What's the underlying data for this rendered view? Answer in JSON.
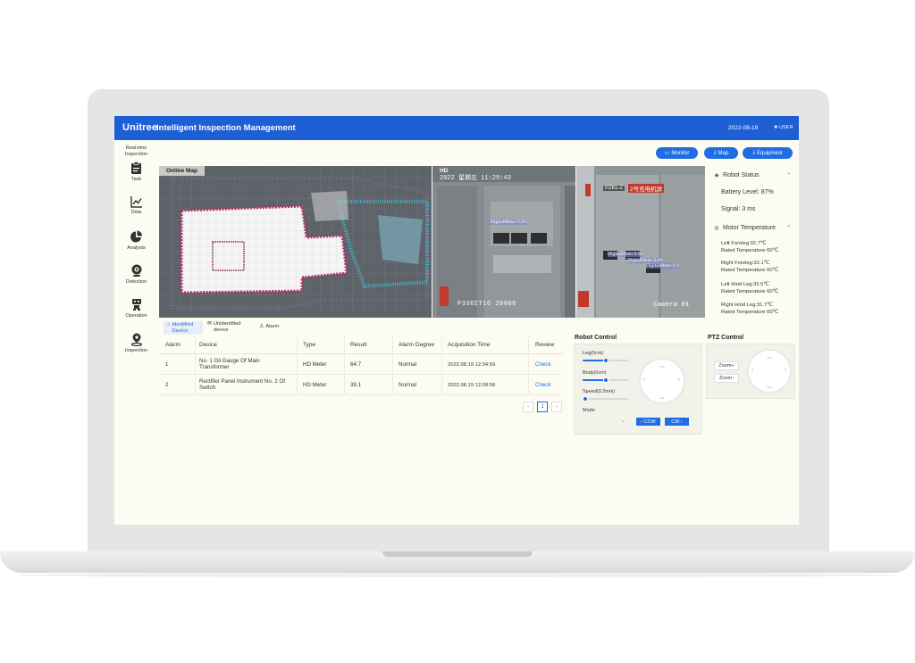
{
  "header": {
    "brand": "Unitree",
    "title": "Intelligent Inspection Management",
    "date": "2022-08-19",
    "user": "✚ USER"
  },
  "sidebar": {
    "heading": "Real-time Inspection",
    "items": [
      {
        "label": "Task",
        "icon": "clipboard-icon"
      },
      {
        "label": "Data",
        "icon": "line-chart-icon"
      },
      {
        "label": "Analysis",
        "icon": "pie-chart-icon"
      },
      {
        "label": "Detection",
        "icon": "camera-icon"
      },
      {
        "label": "Operation",
        "icon": "robot-icon"
      },
      {
        "label": "Inspection",
        "icon": "location-pin-icon"
      }
    ]
  },
  "actions": {
    "monitor": "Monitor",
    "map": "Map",
    "equipment": "Equipment"
  },
  "map_panel": {
    "label": "Online Map"
  },
  "camera": {
    "hd_label": "HD",
    "timestamp": "2022 星期五 11:29:43",
    "detections": [
      "DigitalMeter 0.93",
      "DigitalMeter 0.92",
      "DigitalMeter 0.89",
      "DigitalMeter 0.9"
    ],
    "overlay_left": "P336IT16 20006",
    "overlay_right": "Camera 01",
    "panel_plate": "PZ61-Z",
    "panel_sign": "2号充电机屏"
  },
  "robot_status": {
    "heading": "Robot Status",
    "battery": "Battery Level:  87%",
    "signal": "Signal:  3 ms"
  },
  "motor_temperature": {
    "heading": "Motor Temperature",
    "legs": [
      {
        "name": "Left Foreleg:32.7℃",
        "rated": "Rated Temperature 60℃"
      },
      {
        "name": "Right Foreleg:32.1℃",
        "rated": "Rated Temperature 60℃"
      },
      {
        "name": "Left Hind Leg:32.5℃",
        "rated": "Rated Temperature 60℃"
      },
      {
        "name": "Right Hind Leg:31.7℃",
        "rated": "Rated Temperature 60℃"
      }
    ]
  },
  "tabs": [
    {
      "label": "Identified Device",
      "icon": "home-icon",
      "active": true
    },
    {
      "label": "Unidentified device",
      "icon": "mail-icon",
      "active": false
    },
    {
      "label": "Alarm",
      "icon": "user-icon",
      "active": false
    }
  ],
  "table": {
    "headers": [
      "Alarm",
      "Device",
      "Type",
      "Result",
      "Alarm Degree",
      "Acquisition Time",
      "Review"
    ],
    "rows": [
      {
        "alarm": "1",
        "device": "No. 1 Oil Gauge Of Main Transformer",
        "type": "HD Meter",
        "result": "64.7",
        "degree": "Normal",
        "time": "2022.08.19 12:34:59",
        "review": "Check"
      },
      {
        "alarm": "2",
        "device": "Rectifier Panel Instrument No. 2 Of Switch",
        "type": "HD Meter",
        "result": "39.1",
        "degree": "Normal",
        "time": "2022.08.19 12:28:58",
        "review": "Check"
      }
    ]
  },
  "pagination": {
    "prev": "‹",
    "current": "1",
    "next": "›"
  },
  "robot_control": {
    "title": "Robot Control",
    "leg_label": "Leg(0cm)",
    "leg_value": 0.5,
    "body_label": "Body(0cm)",
    "body_value": 0.5,
    "speed_label": "Speed(0.2m/s)",
    "speed_value": 0.05,
    "mode_label": "Mode",
    "ccw": "‹  CCW",
    "cw": "CW  ›"
  },
  "ptz": {
    "title": "PTZ Control",
    "zoom_in": "Zoom+",
    "zoom_out": "Zoom-"
  },
  "colors": {
    "primary": "#1f5fd6",
    "accent": "#1f6de3",
    "page_bg": "#fdfcf3"
  }
}
